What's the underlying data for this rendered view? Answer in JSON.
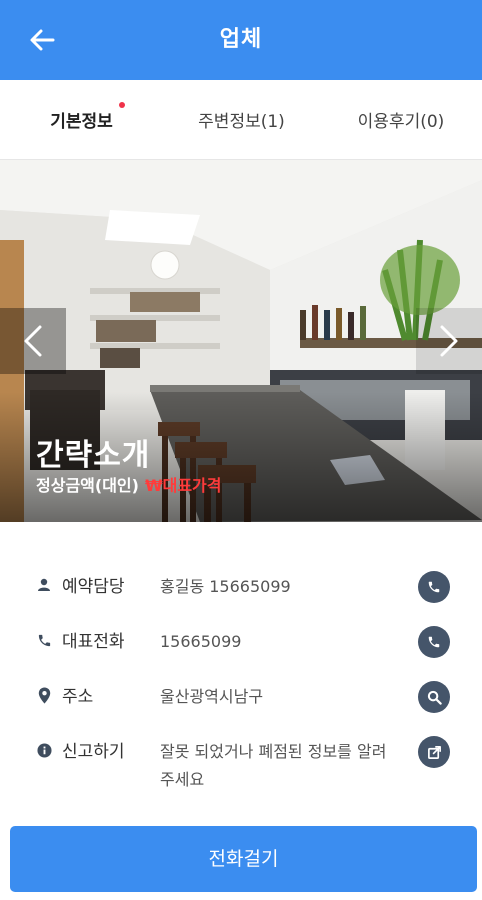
{
  "header": {
    "title": "업체",
    "back_icon": "arrow-left-icon"
  },
  "tabs": [
    {
      "label": "기본정보",
      "active": true,
      "has_dot": true
    },
    {
      "label": "주변정보(1)"
    },
    {
      "label": "이용후기(0)"
    }
  ],
  "hero": {
    "caption": "간략소개",
    "subtitle": "정상금액(대인)",
    "price_label": "₩대표가격",
    "prev_icon": "chevron-left-icon",
    "next_icon": "chevron-right-icon"
  },
  "info": [
    {
      "icon": "person-icon",
      "label": "예약담당",
      "value": "홍길동 15665099",
      "action_icon": "phone-icon"
    },
    {
      "icon": "phone-icon",
      "label": "대표전화",
      "value": "15665099",
      "action_icon": "phone-icon"
    },
    {
      "icon": "location-pin-icon",
      "label": "주소",
      "value": "울산광역시남구",
      "action_icon": "search-icon"
    },
    {
      "icon": "info-icon",
      "label": "신고하기",
      "value": "잘못 되었거나 폐점된 정보를 알려주세요",
      "action_icon": "external-link-icon"
    }
  ],
  "call_button": {
    "label": "전화걸기"
  },
  "colors": {
    "primary": "#3b8df0",
    "accent_red": "#ff3b3b",
    "action_circle": "#45556a"
  }
}
